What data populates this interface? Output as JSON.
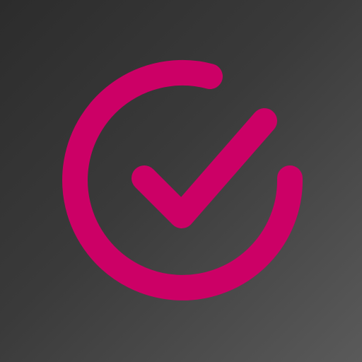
{
  "icon": {
    "name": "circle-check-icon",
    "accent_color": "#cc0066",
    "background_colors": [
      "#2c2c2c",
      "#5a5a5a"
    ]
  }
}
